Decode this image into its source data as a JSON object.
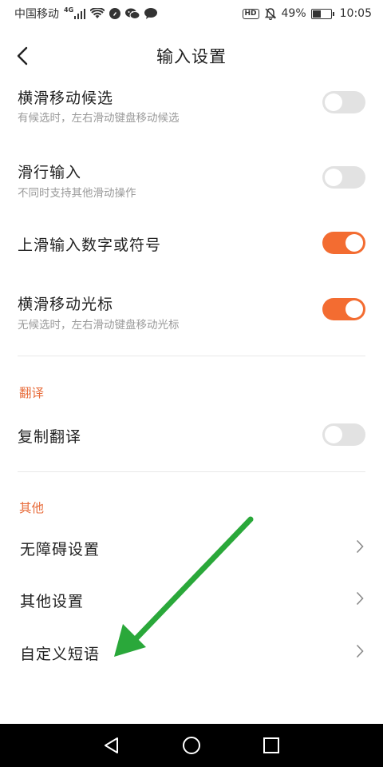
{
  "status_bar": {
    "carrier": "中国移动",
    "network": "4G",
    "battery_text": "49%",
    "battery_level": 0.49,
    "time": "10:05",
    "hd_label": "HD"
  },
  "header": {
    "title": "输入设置"
  },
  "settings": [
    {
      "title": "横滑移动候选",
      "subtitle": "有候选时，左右滑动键盘移动候选",
      "enabled": false
    },
    {
      "title": "滑行输入",
      "subtitle": "不同时支持其他滑动操作",
      "enabled": false
    },
    {
      "title": "上滑输入数字或符号",
      "subtitle": "",
      "enabled": true
    },
    {
      "title": "横滑移动光标",
      "subtitle": "无候选时，左右滑动键盘移动光标",
      "enabled": true
    }
  ],
  "translate_section": {
    "label": "翻译",
    "items": [
      {
        "title": "复制翻译",
        "enabled": false
      }
    ]
  },
  "other_section": {
    "label": "其他",
    "items": [
      {
        "title": "无障碍设置"
      },
      {
        "title": "其他设置"
      },
      {
        "title": "自定义短语"
      }
    ]
  },
  "colors": {
    "accent": "#f36c31",
    "section_label": "#e86d3c",
    "toggle_off": "#e2e2e2",
    "annotation_arrow": "#2aa83a"
  },
  "icons": {
    "back": "chevron-left-icon",
    "nav_item": "chevron-right-icon",
    "nav_back": "triangle-back-icon",
    "nav_home": "circle-home-icon",
    "nav_recent": "square-recent-icon"
  }
}
